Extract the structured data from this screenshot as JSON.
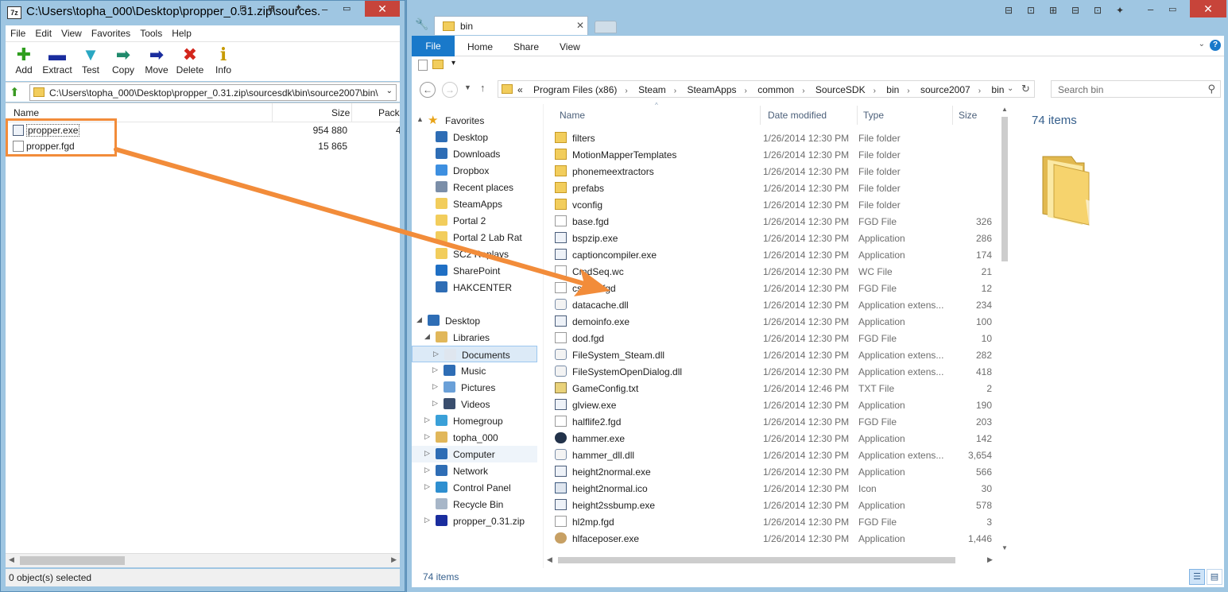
{
  "zip_window": {
    "title": "C:\\Users\\topha_000\\Desktop\\propper_0.31.zip\\sources...",
    "menu": [
      "File",
      "Edit",
      "View",
      "Favorites",
      "Tools",
      "Help"
    ],
    "toolbar": [
      {
        "label": "Add",
        "icon": "plus-icon",
        "color": "#2f9e1f",
        "glyph": "✚"
      },
      {
        "label": "Extract",
        "icon": "minus-icon",
        "color": "#1a2d9e",
        "glyph": "▬"
      },
      {
        "label": "Test",
        "icon": "check-arrow-icon",
        "color": "#2aa7c2",
        "glyph": "▼"
      },
      {
        "label": "Copy",
        "icon": "copy-arrow-icon",
        "color": "#1f8a6c",
        "glyph": "➡"
      },
      {
        "label": "Move",
        "icon": "move-arrow-icon",
        "color": "#1a2d9e",
        "glyph": "➡"
      },
      {
        "label": "Delete",
        "icon": "delete-x-icon",
        "color": "#d3261c",
        "glyph": "✖"
      },
      {
        "label": "Info",
        "icon": "info-icon",
        "color": "#c79a00",
        "glyph": "i"
      }
    ],
    "address": "C:\\Users\\topha_000\\Desktop\\propper_0.31.zip\\sourcesdk\\bin\\source2007\\bin\\",
    "columns": {
      "name": "Name",
      "size": "Size",
      "packed": "Pack"
    },
    "files": [
      {
        "name": "propper.exe",
        "size": "954 880",
        "packed": "4"
      },
      {
        "name": "propper.fgd",
        "size": "15 865",
        "packed": ""
      }
    ],
    "status": "0 object(s) selected"
  },
  "explorer": {
    "tab_label": "bin",
    "ribbon_tabs": [
      "File",
      "Home",
      "Share",
      "View"
    ],
    "breadcrumb_prefix": "«",
    "breadcrumb": [
      "Program Files (x86)",
      "Steam",
      "SteamApps",
      "common",
      "SourceSDK",
      "bin",
      "source2007",
      "bin"
    ],
    "search_placeholder": "Search bin",
    "nav": [
      {
        "label": "Favorites",
        "icon": "star-icon",
        "color": "#e8a317",
        "indent": 0,
        "expander": "▲"
      },
      {
        "label": "Desktop",
        "icon": "desktop-icon",
        "color": "#2e6db5",
        "indent": 1
      },
      {
        "label": "Downloads",
        "icon": "downloads-icon",
        "color": "#2e6db5",
        "indent": 1
      },
      {
        "label": "Dropbox",
        "icon": "dropbox-icon",
        "color": "#3d8fe0",
        "indent": 1
      },
      {
        "label": "Recent places",
        "icon": "recent-places-icon",
        "color": "#7b8ea8",
        "indent": 1
      },
      {
        "label": "SteamApps",
        "icon": "folder-icon",
        "color": "#f2cd5c",
        "indent": 1
      },
      {
        "label": "Portal 2",
        "icon": "folder-icon",
        "color": "#f2cd5c",
        "indent": 1
      },
      {
        "label": "Portal 2 Lab Rat",
        "icon": "folder-icon",
        "color": "#f2cd5c",
        "indent": 1
      },
      {
        "label": "SC2 Replays",
        "icon": "folder-icon",
        "color": "#f2cd5c",
        "indent": 1
      },
      {
        "label": "SharePoint",
        "icon": "sharepoint-icon",
        "color": "#1f6fc4",
        "indent": 1
      },
      {
        "label": "HAKCENTER",
        "icon": "computer-icon",
        "color": "#2e6db5",
        "indent": 1
      },
      {
        "label": "",
        "spacer": true
      },
      {
        "label": "Desktop",
        "icon": "desktop-icon",
        "color": "#2e6db5",
        "indent": 0,
        "expander": "◢"
      },
      {
        "label": "Libraries",
        "icon": "libraries-icon",
        "color": "#e1b75a",
        "indent": 1,
        "expander": "◢"
      },
      {
        "label": "Documents",
        "icon": "documents-icon",
        "color": "#dfe6ef",
        "indent": 2,
        "expander": "▷",
        "selected": true
      },
      {
        "label": "Music",
        "icon": "music-icon",
        "color": "#2e6db5",
        "indent": 2,
        "expander": "▷"
      },
      {
        "label": "Pictures",
        "icon": "pictures-icon",
        "color": "#6aa0d8",
        "indent": 2,
        "expander": "▷"
      },
      {
        "label": "Videos",
        "icon": "videos-icon",
        "color": "#3a4e6e",
        "indent": 2,
        "expander": "▷"
      },
      {
        "label": "Homegroup",
        "icon": "homegroup-icon",
        "color": "#3aa0d8",
        "indent": 1,
        "expander": "▷"
      },
      {
        "label": "topha_000",
        "icon": "user-folder-icon",
        "color": "#e1b75a",
        "indent": 1,
        "expander": "▷"
      },
      {
        "label": "Computer",
        "icon": "computer-icon",
        "color": "#2e6db5",
        "indent": 1,
        "expander": "▷",
        "hover": true
      },
      {
        "label": "Network",
        "icon": "network-icon",
        "color": "#2e6db5",
        "indent": 1,
        "expander": "▷"
      },
      {
        "label": "Control Panel",
        "icon": "control-panel-icon",
        "color": "#2e8fd0",
        "indent": 1,
        "expander": "▷"
      },
      {
        "label": "Recycle Bin",
        "icon": "recycle-bin-icon",
        "color": "#a7b6c8",
        "indent": 1
      },
      {
        "label": "propper_0.31.zip",
        "icon": "zip-icon",
        "color": "#1a2d9e",
        "indent": 1,
        "expander": "▷"
      }
    ],
    "columns": {
      "name": "Name",
      "date": "Date modified",
      "type": "Type",
      "size": "Size"
    },
    "files": [
      {
        "name": "filters",
        "date": "1/26/2014 12:30 PM",
        "type": "File folder",
        "size": "",
        "kind": "folder"
      },
      {
        "name": "MotionMapperTemplates",
        "date": "1/26/2014 12:30 PM",
        "type": "File folder",
        "size": "",
        "kind": "folder"
      },
      {
        "name": "phonemeextractors",
        "date": "1/26/2014 12:30 PM",
        "type": "File folder",
        "size": "",
        "kind": "folder"
      },
      {
        "name": "prefabs",
        "date": "1/26/2014 12:30 PM",
        "type": "File folder",
        "size": "",
        "kind": "folder"
      },
      {
        "name": "vconfig",
        "date": "1/26/2014 12:30 PM",
        "type": "File folder",
        "size": "",
        "kind": "folder"
      },
      {
        "name": "base.fgd",
        "date": "1/26/2014 12:30 PM",
        "type": "FGD File",
        "size": "326",
        "kind": "file"
      },
      {
        "name": "bspzip.exe",
        "date": "1/26/2014 12:30 PM",
        "type": "Application",
        "size": "286",
        "kind": "exe"
      },
      {
        "name": "captioncompiler.exe",
        "date": "1/26/2014 12:30 PM",
        "type": "Application",
        "size": "174",
        "kind": "exe"
      },
      {
        "name": "CmdSeq.wc",
        "date": "1/26/2014 12:30 PM",
        "type": "WC File",
        "size": "21",
        "kind": "file"
      },
      {
        "name": "cstrike.fgd",
        "date": "1/26/2014 12:30 PM",
        "type": "FGD File",
        "size": "12",
        "kind": "file"
      },
      {
        "name": "datacache.dll",
        "date": "1/26/2014 12:30 PM",
        "type": "Application extens...",
        "size": "234",
        "kind": "dll"
      },
      {
        "name": "demoinfo.exe",
        "date": "1/26/2014 12:30 PM",
        "type": "Application",
        "size": "100",
        "kind": "exe"
      },
      {
        "name": "dod.fgd",
        "date": "1/26/2014 12:30 PM",
        "type": "FGD File",
        "size": "10",
        "kind": "file"
      },
      {
        "name": "FileSystem_Steam.dll",
        "date": "1/26/2014 12:30 PM",
        "type": "Application extens...",
        "size": "282",
        "kind": "dll"
      },
      {
        "name": "FileSystemOpenDialog.dll",
        "date": "1/26/2014 12:30 PM",
        "type": "Application extens...",
        "size": "418",
        "kind": "dll"
      },
      {
        "name": "GameConfig.txt",
        "date": "1/26/2014 12:46 PM",
        "type": "TXT File",
        "size": "2",
        "kind": "txt"
      },
      {
        "name": "glview.exe",
        "date": "1/26/2014 12:30 PM",
        "type": "Application",
        "size": "190",
        "kind": "exe"
      },
      {
        "name": "halflife2.fgd",
        "date": "1/26/2014 12:30 PM",
        "type": "FGD File",
        "size": "203",
        "kind": "file"
      },
      {
        "name": "hammer.exe",
        "date": "1/26/2014 12:30 PM",
        "type": "Application",
        "size": "142",
        "kind": "hammer"
      },
      {
        "name": "hammer_dll.dll",
        "date": "1/26/2014 12:30 PM",
        "type": "Application extens...",
        "size": "3,654",
        "kind": "dll"
      },
      {
        "name": "height2normal.exe",
        "date": "1/26/2014 12:30 PM",
        "type": "Application",
        "size": "566",
        "kind": "exe"
      },
      {
        "name": "height2normal.ico",
        "date": "1/26/2014 12:30 PM",
        "type": "Icon",
        "size": "30",
        "kind": "ico"
      },
      {
        "name": "height2ssbump.exe",
        "date": "1/26/2014 12:30 PM",
        "type": "Application",
        "size": "578",
        "kind": "exe"
      },
      {
        "name": "hl2mp.fgd",
        "date": "1/26/2014 12:30 PM",
        "type": "FGD File",
        "size": "3",
        "kind": "file"
      },
      {
        "name": "hlfaceposer.exe",
        "date": "1/26/2014 12:30 PM",
        "type": "Application",
        "size": "1,446",
        "kind": "face"
      }
    ],
    "item_count": "74 items",
    "status_count": "74 items"
  },
  "colors": {
    "annotation": "#f28c3a",
    "accent": "#1979ca"
  }
}
